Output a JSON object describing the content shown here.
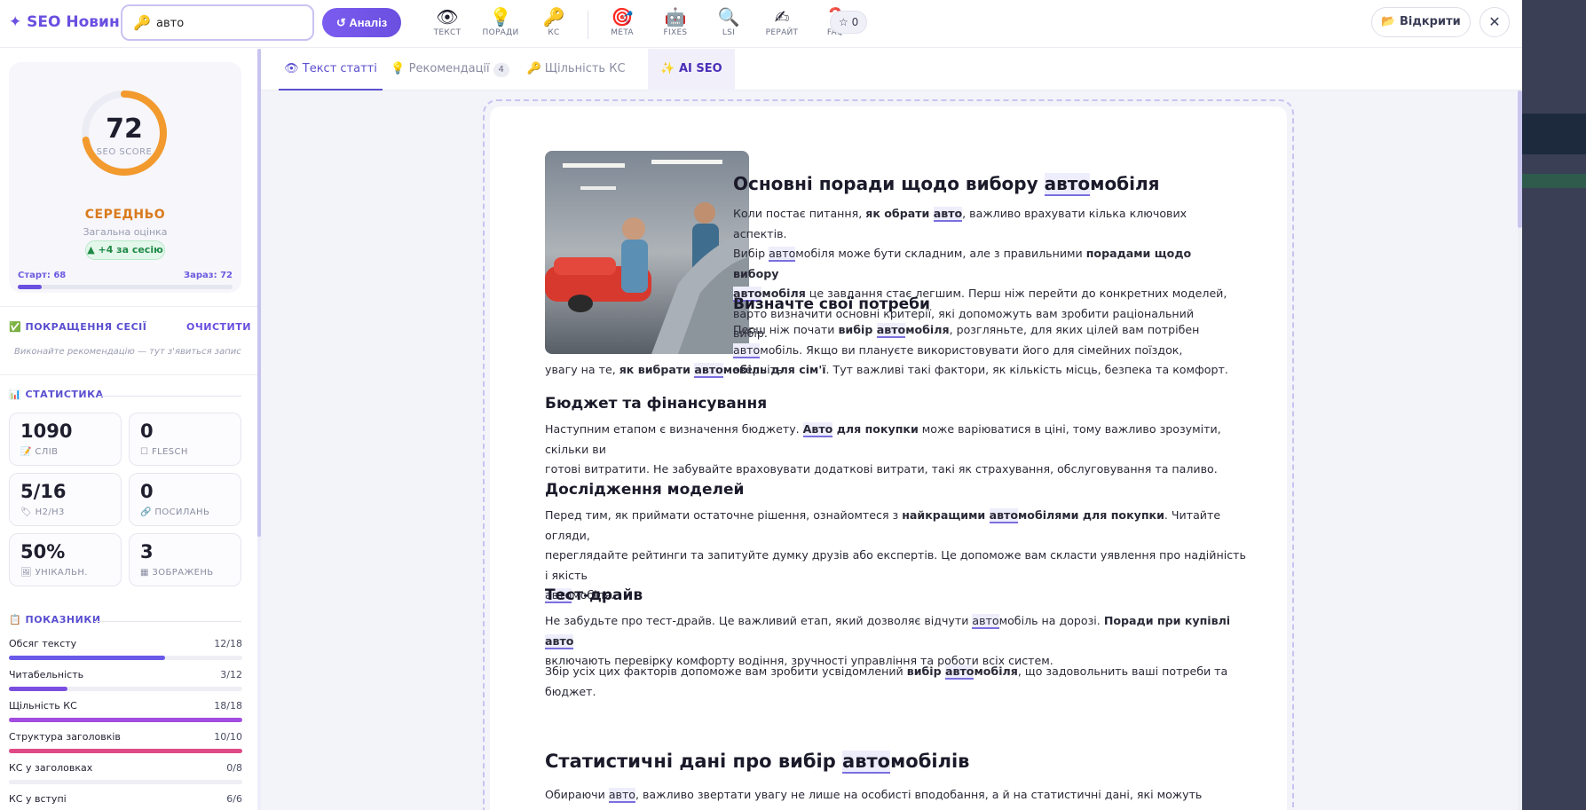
{
  "brand": "✦ SEO Новини",
  "search": {
    "value": "авто"
  },
  "analyze_label": "↺ Аналіз",
  "tools": [
    {
      "icon": "👁",
      "label": "ТЕКСТ",
      "name": "text"
    },
    {
      "icon": "💡",
      "label": "ПОРАДИ",
      "name": "tips"
    },
    {
      "icon": "🔑",
      "label": "КС",
      "name": "keywords"
    },
    {
      "icon": "🎯",
      "label": "META",
      "name": "meta"
    },
    {
      "icon": "🤖",
      "label": "FIXES",
      "name": "fixes"
    },
    {
      "icon": "🔍",
      "label": "LSI",
      "name": "lsi"
    },
    {
      "icon": "✍",
      "label": "РЕРАЙТ",
      "name": "rewrite"
    },
    {
      "icon": "❓",
      "label": "FAQ",
      "name": "faq"
    }
  ],
  "stars": "☆ 0",
  "open_label": "📂 Відкрити",
  "close_icon": "✕",
  "score": {
    "value": "72",
    "label": "SEO SCORE",
    "fraction": 0.72,
    "level": "СЕРЕДНЬО",
    "overall": "Загальна оцінка",
    "session_badge": "▲ +4 за сесію",
    "start": "Старт: 68",
    "now": "Зараз: 72",
    "progress": 0.11,
    "ring_color": "#f29a2e"
  },
  "improvements": {
    "title": "ПОКРАЩЕННЯ СЕСІЇ",
    "clear": "ОЧИСТИТИ",
    "empty": "Виконайте рекомендацію — тут з'явиться запис"
  },
  "stats": {
    "title": "СТАТИСТИКА",
    "items": [
      {
        "value": "1090",
        "label": "📝 СЛІВ"
      },
      {
        "value": "0",
        "label": "☐ FLESCH"
      },
      {
        "value": "5/16",
        "label": "🏷 H2/H3"
      },
      {
        "value": "0",
        "label": "🔗 ПОСИЛАНЬ"
      },
      {
        "value": "50%",
        "label": "🖼 УНІКАЛЬН."
      },
      {
        "value": "3",
        "label": "▦ ЗОБРАЖЕНЬ"
      }
    ]
  },
  "metrics": {
    "title": "ПОКАЗНИКИ",
    "items": [
      {
        "name": "Обсяг тексту",
        "value": "12/18",
        "fraction": 0.67,
        "color": "#6a5ae8"
      },
      {
        "name": "Читабельність",
        "value": "3/12",
        "fraction": 0.25,
        "color": "#7a4fe0"
      },
      {
        "name": "Щільність КС",
        "value": "18/18",
        "fraction": 1.0,
        "color": "#a24de0"
      },
      {
        "name": "Структура заголовків",
        "value": "10/10",
        "fraction": 1.0,
        "color": "#e04a86"
      },
      {
        "name": "КС у заголовках",
        "value": "0/8",
        "fraction": 0.0,
        "color": "#e04a86"
      },
      {
        "name": "КС у вступі",
        "value": "6/6",
        "fraction": 1.0,
        "color": "#e04a86"
      }
    ]
  },
  "tabs": [
    {
      "label": "👁 Текст статті"
    },
    {
      "label": "💡 Рекомендації",
      "count": "4"
    },
    {
      "label": "🔑 Щільність КС"
    },
    {
      "label": "✨ AI SEO"
    }
  ],
  "article": {
    "h1": [
      "Основні поради щодо вибору ",
      "авто",
      "мобіля"
    ],
    "p1": {
      "a": "Коли постає питання, ",
      "b": "як обрати ",
      "kw1": "авто",
      "c": ", важливо врахувати кілька ключових аспектів.",
      "d": "Вибір ",
      "kw2": "авто",
      "e": "мобіля може бути складним, але з правильними ",
      "f": "порадами щодо вибору",
      "kw3": "авто",
      "g": "мобіля",
      "h": " це завдання стає легшим. Перш ніж перейти до конкретних моделей,",
      "i": "варто визначити основні критерії, які допоможуть вам зробити раціональний вибір."
    },
    "h2a": "Визначте свої потреби",
    "p2": {
      "a": "Перш ніж почати ",
      "b": "вибір ",
      "kw1": "авто",
      "c": "мобіля",
      "d": ", розгляньте, для яких цілей вам потрібен",
      "kw2": "авто",
      "e": "мобіль. Якщо ви плануєте використовувати його для сімейних поїздок, зверніть",
      "f": "увагу на те, ",
      "g": "як вибрати ",
      "kw3": "авто",
      "h": "мобіль для сім'ї",
      "i": ". Тут важливі такі фактори, як кількість місць, безпека та комфорт."
    },
    "h2b": "Бюджет та фінансування",
    "p3": {
      "a": "Наступним етапом є визначення бюджету. ",
      "kw1": "Авто",
      "b": " для покупки",
      "c": " може варіюватися в ціні, тому важливо зрозуміти, скільки ви",
      "d": "готові витратити. Не забувайте враховувати додаткові витрати, такі як страхування, обслуговування та паливо."
    },
    "h2c": "Дослідження моделей",
    "p4": {
      "a": "Перед тим, як приймати остаточне рішення, ознайомтеся з ",
      "b": "найкращими ",
      "kw1": "авто",
      "c": "мобілями для покупки",
      "d": ". Читайте огляди,",
      "e": "переглядайте рейтинги та запитуйте думку друзів або експертів. Це допоможе вам скласти уявлення про надійність і якість",
      "kw2": "авто",
      "f": "мобіля."
    },
    "h2d": "Тест-драйв",
    "p5": {
      "a": "Не забудьте про тест-драйв. Це важливий етап, який дозволяє відчути ",
      "kw1": "авто",
      "b": "мобіль на дорозі. ",
      "c": "Поради при купівлі ",
      "kw2": "авто",
      "d": "включають перевірку комфорту водіння, зручності управління та роботи всіх систем."
    },
    "p6": {
      "a": "Збір усіх цих факторів допоможе вам зробити усвідомлений ",
      "b": "вибір ",
      "kw1": "авто",
      "c": "мобіля",
      "d": ", що задовольнить ваші потреби та бюджет."
    },
    "h1b": [
      "Статистичні дані про вибір ",
      "авто",
      "мобілів"
    ],
    "p7": {
      "a": "Обираючи ",
      "kw1": "авто",
      "b": ", важливо звертати увагу не лише на особисті вподобання, а й на статистичні дані, які можуть допомогти в"
    }
  }
}
